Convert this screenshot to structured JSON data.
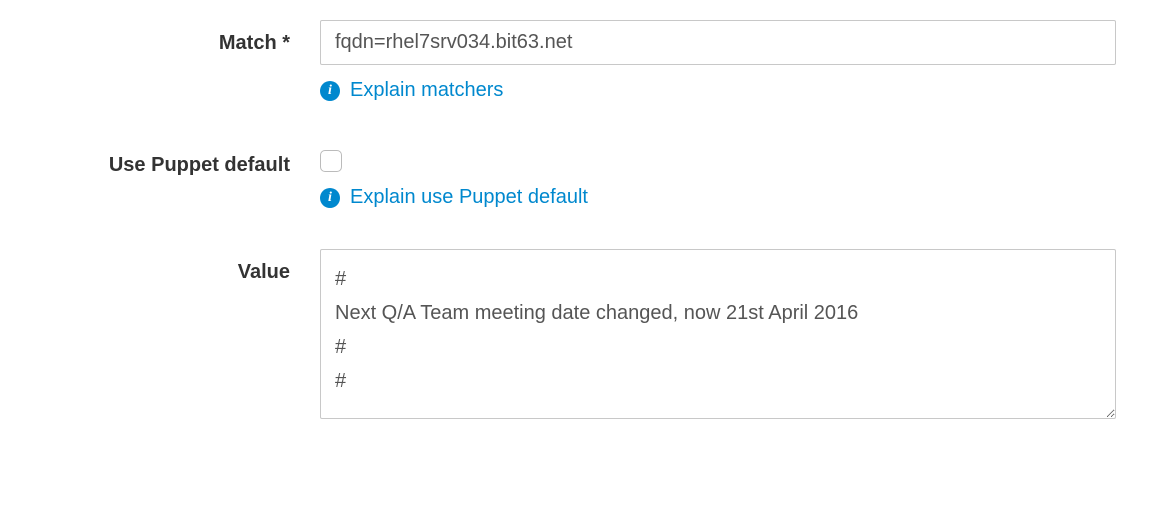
{
  "fields": {
    "match": {
      "label": "Match *",
      "value": "fqdn=rhel7srv034.bit63.net",
      "help": "Explain matchers"
    },
    "puppetDefault": {
      "label": "Use Puppet default",
      "checked": false,
      "help": "Explain use Puppet default"
    },
    "value": {
      "label": "Value",
      "content": "#\nNext Q/A Team meeting date changed, now 21st April 2016\n#\n#"
    }
  }
}
